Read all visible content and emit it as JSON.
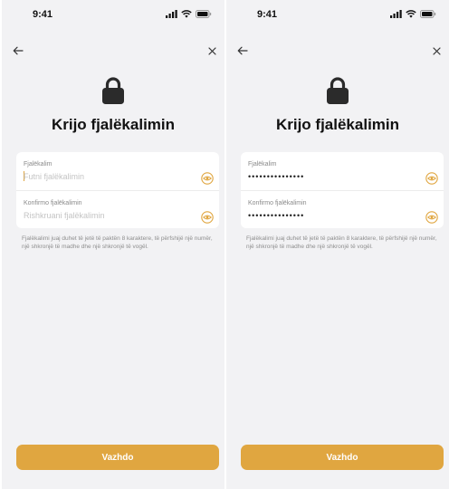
{
  "colors": {
    "accent": "#e0a640",
    "background": "#f2f2f4",
    "card": "#ffffff",
    "hint": "#8e8e8e"
  },
  "status_bar": {
    "time": "9:41",
    "icons": [
      "cellular-signal-icon",
      "wifi-icon",
      "battery-icon"
    ]
  },
  "screens": [
    {
      "title": "Krijo fjalëkalimin",
      "nav": {
        "back_icon": "arrow-left-icon",
        "close_icon": "close-icon"
      },
      "lock_icon": "lock-icon",
      "password_field": {
        "label": "Fjalëkalim",
        "value": "",
        "placeholder": "Futni fjalëkalimin",
        "eye_icon": "eye-icon"
      },
      "confirm_field": {
        "label": "Konfirmo fjalëkalimin",
        "value": "",
        "placeholder": "Rishkruani fjalëkalimin",
        "eye_icon": "eye-icon"
      },
      "hint": "Fjalëkalimi juaj duhet të jetë të paktën 8 karaktere, të përfshijë një numër, një shkronjë të madhe dhe një shkronjë të vogël.",
      "continue_label": "Vazhdo"
    },
    {
      "title": "Krijo fjalëkalimin",
      "nav": {
        "back_icon": "arrow-left-icon",
        "close_icon": "close-icon"
      },
      "lock_icon": "lock-icon",
      "password_field": {
        "label": "Fjalëkalim",
        "value": "•••••••••••••••",
        "placeholder": "",
        "eye_icon": "eye-icon"
      },
      "confirm_field": {
        "label": "Konfirmo fjalëkalimin",
        "value": "•••••••••••••••",
        "placeholder": "",
        "eye_icon": "eye-icon"
      },
      "hint": "Fjalëkalimi juaj duhet të jetë të paktën 8 karaktere, të përfshijë një numër, një shkronjë të madhe dhe një shkronjë të vogël.",
      "continue_label": "Vazhdo"
    }
  ]
}
